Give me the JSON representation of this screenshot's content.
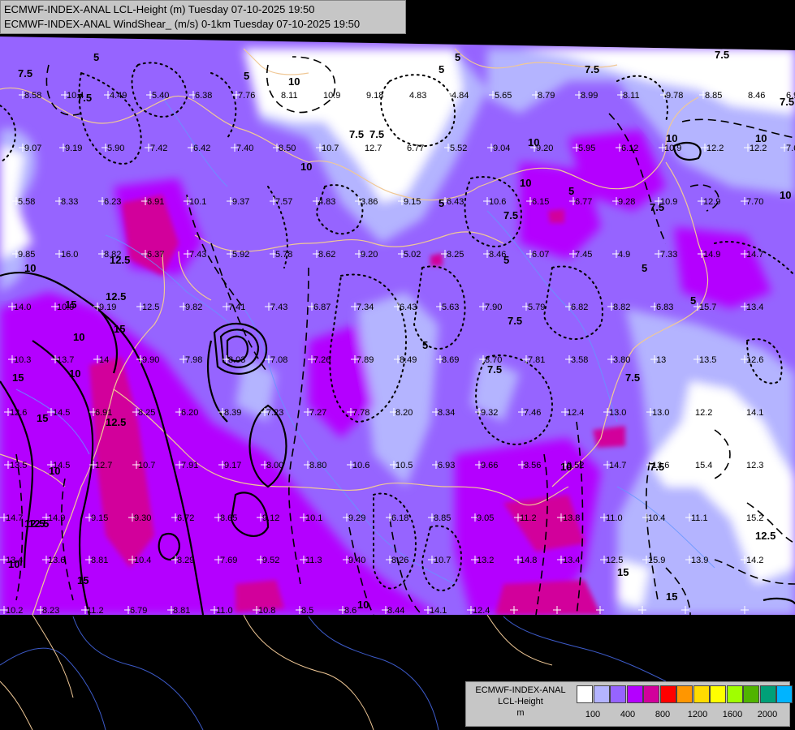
{
  "header": {
    "line1": "ECMWF-INDEX-ANAL LCL-Height (m) Tuesday 07-10-2025 19:50",
    "line2": "ECMWF-INDEX-ANAL WindShear_ (m/s) 0-1km Tuesday 07-10-2025 19:50"
  },
  "legend": {
    "title1": "ECMWF-INDEX-ANAL",
    "title2": "LCL-Height",
    "unit": "m",
    "colors": [
      "#ffffff",
      "#b4b4ff",
      "#9664ff",
      "#b400ff",
      "#d2009b",
      "#ff0000",
      "#ff9600",
      "#ffdc00",
      "#ffff00",
      "#a0ff00",
      "#50b400",
      "#00a078",
      "#00b4ff"
    ],
    "ticks": [
      "100",
      "400",
      "800",
      "1200",
      "1600",
      "2000"
    ]
  },
  "colors": {
    "background": "#000000",
    "panel": "#c6c6c6",
    "border": "#f0c896",
    "river": "#6496ff"
  },
  "contour_labels": [
    "7.5",
    "7.5",
    "5",
    "5",
    "10",
    "7.5",
    "5",
    "7.5",
    "10",
    "7.5",
    "5",
    "10",
    "10",
    "15",
    "12.5",
    "15",
    "10",
    "15",
    "12.5",
    "10",
    "15",
    "12.5",
    "10",
    "12.5",
    "15",
    "15",
    "7.5",
    "5",
    "10",
    "7.5",
    "7.5",
    "10",
    "5",
    "7.5",
    "5",
    "5",
    "10",
    "7.5",
    "12.5",
    "10",
    "15",
    "7.5",
    "7.5",
    "10",
    "7.5",
    "5",
    "10",
    "5",
    "10",
    "12.5"
  ],
  "values": [
    "8.58",
    "10.4",
    "4.49",
    "5.40",
    "6.38",
    "7.76",
    "8.11",
    "10.9",
    "9.18",
    "4.83",
    "4.84",
    "5.65",
    "8.79",
    "8.99",
    "8.11",
    "9.78",
    "8.85",
    "8.46",
    "6.97",
    "9.07",
    "9.19",
    "5.90",
    "7.42",
    "6.42",
    "7.40",
    "8.50",
    "10.7",
    "12.7",
    "6.77",
    "5.52",
    "9.04",
    "9.20",
    "5.95",
    "6.12",
    "10.9",
    "12.2",
    "12.2",
    "7.69",
    "5.58",
    "8.33",
    "6.23",
    "6.91",
    "10.1",
    "9.37",
    "7.57",
    "4.83",
    "3.86",
    "9.15",
    "6.43",
    "10.6",
    "6.15",
    "6.77",
    "9.28",
    "10.9",
    "12.9",
    "7.70",
    "9.85",
    "16.0",
    "8.82",
    "6.37",
    "7.43",
    "5.92",
    "5.78",
    "8.62",
    "9.20",
    "5.02",
    "8.25",
    "8.46",
    "6.07",
    "7.45",
    "4.9",
    "7.33",
    "14.9",
    "14.7",
    "14.0",
    "10.9",
    "9.19",
    "12.5",
    "9.82",
    "7.41",
    "7.43",
    "6.87",
    "7.34",
    "6.43",
    "5.63",
    "7.90",
    "5.79",
    "6.82",
    "8.82",
    "6.83",
    "15.7",
    "13.4",
    "10.3",
    "13.7",
    "14",
    "9.90",
    "7.98",
    "8.03",
    "7.08",
    "7.26",
    "7.89",
    "8.49",
    "8.69",
    "8.70",
    "7.81",
    "3.58",
    "3.80",
    "13",
    "13.5",
    "12.6",
    "12.6",
    "14.5",
    "6.91",
    "8.25",
    "6.20",
    "8.39",
    "7.23",
    "7.27",
    "7.78",
    "8.20",
    "8.34",
    "9.32",
    "7.46",
    "12.4",
    "13.0",
    "13.0",
    "12.2",
    "14.1",
    "13.5",
    "14.5",
    "12.7",
    "10.7",
    "7.91",
    "9.17",
    "8.00",
    "8.80",
    "10.6",
    "10.5",
    "6.93",
    "9.66",
    "8.56",
    "9.52",
    "14.7",
    "13.6",
    "15.4",
    "12.3",
    "14.7",
    "14.9",
    "9.15",
    "9.30",
    "6.72",
    "8.65",
    "9.12",
    "10.1",
    "9.29",
    "6.18",
    "8.85",
    "9.05",
    "11.2",
    "13.8",
    "11.0",
    "10.4",
    "11.1",
    "15.2",
    "13.4",
    "13.6",
    "8.81",
    "10.4",
    "8.29",
    "7.69",
    "9.52",
    "11.3",
    "9.40",
    "8.26",
    "10.7",
    "13.2",
    "14.8",
    "13.4",
    "12.5",
    "15.9",
    "13.9",
    "14.2",
    "10.2",
    "8.23",
    "11.2",
    "6.79",
    "8.81",
    "11.0",
    "10.8",
    "8.5",
    "8.6",
    "8.44",
    "14.1",
    "12.4"
  ]
}
